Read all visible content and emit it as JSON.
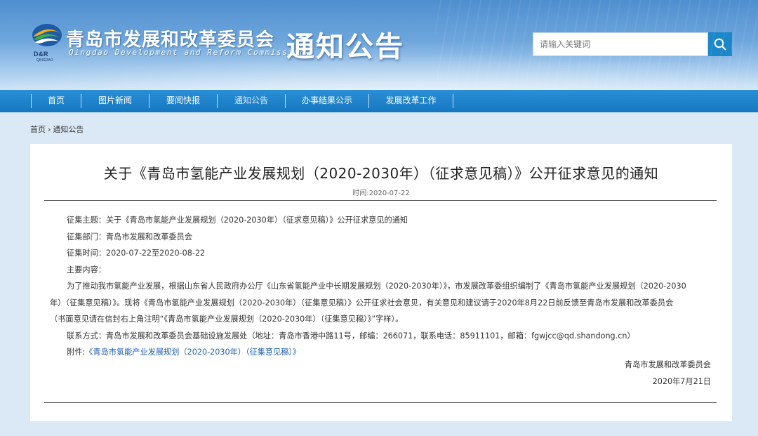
{
  "header": {
    "org_name": "青岛市发展和改革委员会",
    "org_name_en": "Qingdao Development and Reform Commission",
    "logo_text": "D&R",
    "logo_subtext": "QINGDAO",
    "site_title": "通知公告",
    "search_placeholder": "请输入关键词",
    "search_icon": "search-icon",
    "colors": {
      "banner": "#5b9ad6",
      "nav": "#1a7fc6",
      "search_button": "#1b86c9"
    }
  },
  "nav": {
    "items": [
      {
        "label": "首页"
      },
      {
        "label": "图片新闻"
      },
      {
        "label": "要闻快报"
      },
      {
        "label": "通知公告"
      },
      {
        "label": "办事结果公示"
      },
      {
        "label": "发展改革工作"
      }
    ],
    "active_index": 3
  },
  "breadcrumb": {
    "items": [
      "首页",
      "通知公告"
    ],
    "separator": "›"
  },
  "article": {
    "title": "关于《青岛市氢能产业发展规划（2020-2030年）（征求意见稿）》公开征求意见的通知",
    "time": "时间:2020-07-22",
    "subject_label": "征集主题：",
    "subject": "关于《青岛市氢能产业发展规划（2020-2030年）（征求意见稿）》公开征求意见的通知",
    "dept_label": "征集部门：",
    "dept": "青岛市发展和改革委员会",
    "period_label": "征集时间：",
    "period": "2020-07-22至2020-08-22",
    "main_label": "主要内容：",
    "body_line1": "为了推动我市氢能产业发展，根据山东省人民政府办公厅《山东省氢能产业中长期发展规划（2020-2030年）》，市发展改革委组织编制了《青岛市氢能产业发展规划（2020-2030",
    "body_line2": "年）（征集意见稿）》。现将《青岛市氢能产业发展规划（2020-2030年）（征集意见稿）》公开征求社会意见，有关意见和建议请于2020年8月22日前反馈至青岛市发展和改革委员会",
    "body_line3": "（书面意见请在信封右上角注明“《青岛市氢能产业发展规划（2020-2030年）（征集意见稿）》”字样）。",
    "contact_label": "联系方式：",
    "contact": "青岛市发展和改革委员会基础设施发展处（地址：青岛市香港中路11号，邮编：266071，联系电话：85911101，邮箱：fgwjcc@qd.shandong.cn）",
    "attachment_label": "附件:",
    "attachment": "《青岛市氢能产业发展规划（2020-2030年）（征集意见稿）》",
    "signature_org": "青岛市发展和改革委员会",
    "signature_date": "2020年7月21日"
  }
}
